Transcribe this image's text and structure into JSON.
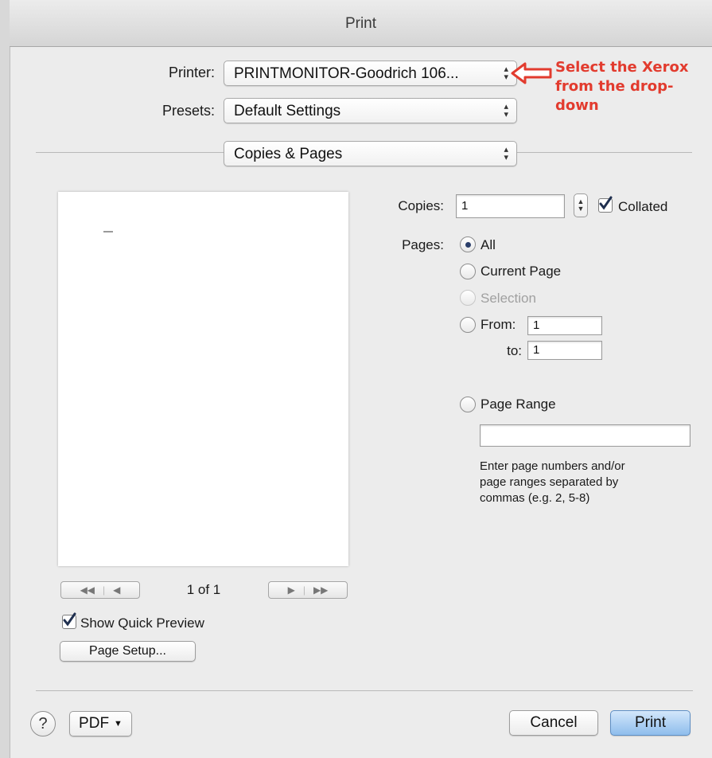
{
  "window": {
    "title": "Print"
  },
  "printer": {
    "label": "Printer:",
    "value": "PRINTMONITOR-Goodrich 106..."
  },
  "presets": {
    "label": "Presets:",
    "value": "Default Settings"
  },
  "section": {
    "value": "Copies & Pages"
  },
  "annotation": {
    "line1": "Select the Xerox",
    "line2": "from the drop-down",
    "color": "#e23b2e"
  },
  "preview": {
    "page_indicator": "1 of 1",
    "show_quick_preview_label": "Show Quick Preview",
    "show_quick_preview_checked": true,
    "page_setup_label": "Page Setup..."
  },
  "copies": {
    "label": "Copies:",
    "value": "1",
    "collated_label": "Collated",
    "collated_checked": true
  },
  "pages": {
    "label": "Pages:",
    "options": [
      {
        "label": "All",
        "selected": true,
        "enabled": true
      },
      {
        "label": "Current Page",
        "selected": false,
        "enabled": true
      },
      {
        "label": "Selection",
        "selected": false,
        "enabled": false
      },
      {
        "label": "From:",
        "selected": false,
        "enabled": true
      }
    ],
    "from_value": "1",
    "to_label": "to:",
    "to_value": "1",
    "page_range_label": "Page Range",
    "page_range_value": "",
    "help_line1": "Enter page numbers and/or",
    "help_line2": "page ranges separated by",
    "help_line3": "commas (e.g. 2, 5-8)"
  },
  "footer": {
    "help_icon": "?",
    "pdf_label": "PDF",
    "cancel_label": "Cancel",
    "print_label": "Print"
  },
  "colors": {
    "primary_button": "#8ebdec",
    "accent": "#2b3f6b"
  }
}
